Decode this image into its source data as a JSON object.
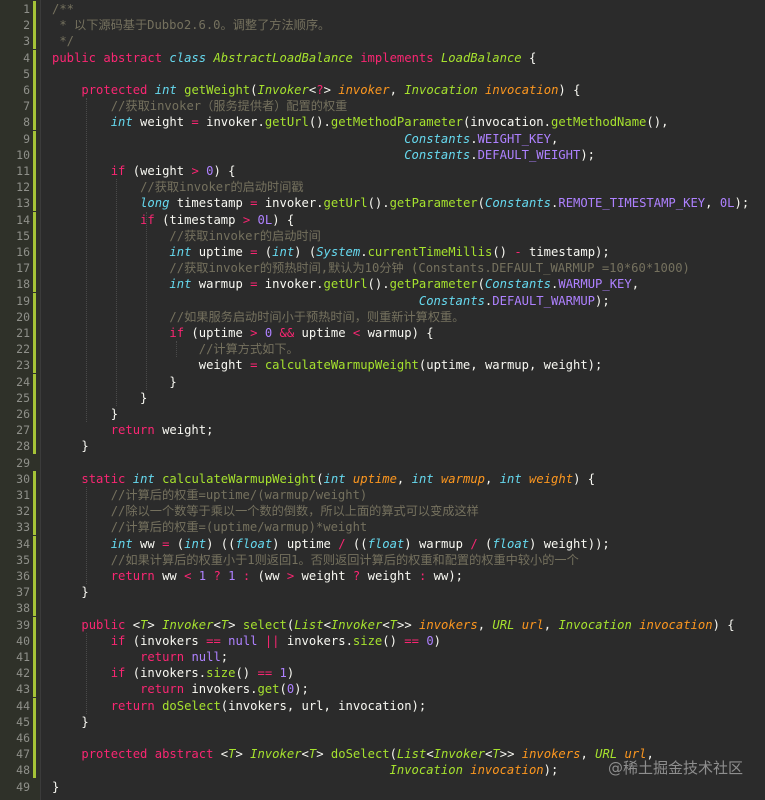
{
  "editor": {
    "theme_colors": {
      "background": "#2b2b2b",
      "line_number": "#8f908a",
      "change_marker": "#a6c437",
      "keyword": "#f92672",
      "type": "#66d9ef",
      "function": "#a6e22e",
      "class_name": "#a6e22e",
      "parameter": "#fd971f",
      "number": "#ae81ff",
      "comment": "#75715e",
      "text": "#f8f8f2"
    },
    "modified_lines": [
      1,
      2,
      3,
      4,
      5,
      6,
      7,
      8,
      9,
      10,
      11,
      12,
      13,
      14,
      15,
      16,
      17,
      18,
      19,
      20,
      21,
      22,
      23,
      24,
      25,
      26,
      27,
      28,
      30,
      31,
      32,
      33,
      34,
      35,
      36,
      37,
      38,
      39,
      40,
      41,
      42,
      43,
      44,
      45,
      46,
      47,
      48
    ],
    "lines": [
      [
        [
          "/**",
          "cm"
        ]
      ],
      [
        [
          " * 以下源码基于Dubbo2.6.0。调整了方法顺序。",
          "cm"
        ]
      ],
      [
        [
          " */",
          "cm"
        ]
      ],
      [
        [
          "public",
          "kw"
        ],
        [
          " ",
          ""
        ],
        [
          "abstract",
          "kw"
        ],
        [
          " ",
          ""
        ],
        [
          "class",
          "ty"
        ],
        [
          " ",
          ""
        ],
        [
          "AbstractLoadBalance",
          "cl"
        ],
        [
          " ",
          ""
        ],
        [
          "implements",
          "kw"
        ],
        [
          " ",
          ""
        ],
        [
          "LoadBalance",
          "cl"
        ],
        [
          " {",
          ""
        ]
      ],
      [
        [
          "",
          ""
        ]
      ],
      [
        [
          "    ",
          ""
        ],
        [
          "protected",
          "kw"
        ],
        [
          " ",
          ""
        ],
        [
          "int",
          "ty"
        ],
        [
          " ",
          ""
        ],
        [
          "getWeight",
          "fn"
        ],
        [
          "(",
          ""
        ],
        [
          "Invoker",
          "cl"
        ],
        [
          "<",
          ""
        ],
        [
          "?",
          "kw"
        ],
        [
          "> ",
          ""
        ],
        [
          "invoker",
          "pa"
        ],
        [
          ", ",
          ""
        ],
        [
          "Invocation",
          "cl"
        ],
        [
          " ",
          ""
        ],
        [
          "invocation",
          "pa"
        ],
        [
          ") {",
          ""
        ]
      ],
      [
        [
          "        ",
          ""
        ],
        [
          "//获取invoker（服务提供者）配置的权重",
          "cm"
        ]
      ],
      [
        [
          "        ",
          ""
        ],
        [
          "int",
          "ty"
        ],
        [
          " weight ",
          ""
        ],
        [
          "=",
          "kw"
        ],
        [
          " invoker.",
          ""
        ],
        [
          "getUrl",
          "fn"
        ],
        [
          "().",
          ""
        ],
        [
          "getMethodParameter",
          "fn"
        ],
        [
          "(invocation.",
          ""
        ],
        [
          "getMethodName",
          "fn"
        ],
        [
          "(),",
          ""
        ]
      ],
      [
        [
          "                                                ",
          ""
        ],
        [
          "Constants",
          "ty"
        ],
        [
          ".",
          ""
        ],
        [
          "WEIGHT_KEY",
          "nu"
        ],
        [
          ",",
          ""
        ]
      ],
      [
        [
          "                                                ",
          ""
        ],
        [
          "Constants",
          "ty"
        ],
        [
          ".",
          ""
        ],
        [
          "DEFAULT_WEIGHT",
          "nu"
        ],
        [
          ");",
          ""
        ]
      ],
      [
        [
          "        ",
          ""
        ],
        [
          "if",
          "kw"
        ],
        [
          " (weight ",
          ""
        ],
        [
          ">",
          "kw"
        ],
        [
          " ",
          ""
        ],
        [
          "0",
          "nu"
        ],
        [
          ") {",
          ""
        ]
      ],
      [
        [
          "            ",
          ""
        ],
        [
          "//获取invoker的启动时间戳",
          "cm"
        ]
      ],
      [
        [
          "            ",
          ""
        ],
        [
          "long",
          "ty"
        ],
        [
          " timestamp ",
          ""
        ],
        [
          "=",
          "kw"
        ],
        [
          " invoker.",
          ""
        ],
        [
          "getUrl",
          "fn"
        ],
        [
          "().",
          ""
        ],
        [
          "getParameter",
          "fn"
        ],
        [
          "(",
          ""
        ],
        [
          "Constants",
          "ty"
        ],
        [
          ".",
          ""
        ],
        [
          "REMOTE_TIMESTAMP_KEY",
          "nu"
        ],
        [
          ", ",
          ""
        ],
        [
          "0L",
          "nu"
        ],
        [
          ");",
          ""
        ]
      ],
      [
        [
          "            ",
          ""
        ],
        [
          "if",
          "kw"
        ],
        [
          " (timestamp ",
          ""
        ],
        [
          ">",
          "kw"
        ],
        [
          " ",
          ""
        ],
        [
          "0L",
          "nu"
        ],
        [
          ") {",
          ""
        ]
      ],
      [
        [
          "                ",
          ""
        ],
        [
          "//获取invoker的启动时间",
          "cm"
        ]
      ],
      [
        [
          "                ",
          ""
        ],
        [
          "int",
          "ty"
        ],
        [
          " uptime ",
          ""
        ],
        [
          "=",
          "kw"
        ],
        [
          " (",
          ""
        ],
        [
          "int",
          "ty"
        ],
        [
          ") (",
          ""
        ],
        [
          "System",
          "ty"
        ],
        [
          ".",
          ""
        ],
        [
          "currentTimeMillis",
          "fn"
        ],
        [
          "() ",
          ""
        ],
        [
          "-",
          "kw"
        ],
        [
          " timestamp);",
          ""
        ]
      ],
      [
        [
          "                ",
          ""
        ],
        [
          "//获取invoker的预热时间,默认为10分钟 (Constants.DEFAULT_WARMUP =10*60*1000)",
          "cm"
        ]
      ],
      [
        [
          "                ",
          ""
        ],
        [
          "int",
          "ty"
        ],
        [
          " warmup ",
          ""
        ],
        [
          "=",
          "kw"
        ],
        [
          " invoker.",
          ""
        ],
        [
          "getUrl",
          "fn"
        ],
        [
          "().",
          ""
        ],
        [
          "getParameter",
          "fn"
        ],
        [
          "(",
          ""
        ],
        [
          "Constants",
          "ty"
        ],
        [
          ".",
          ""
        ],
        [
          "WARMUP_KEY",
          "nu"
        ],
        [
          ",",
          ""
        ]
      ],
      [
        [
          "                                                  ",
          ""
        ],
        [
          "Constants",
          "ty"
        ],
        [
          ".",
          ""
        ],
        [
          "DEFAULT_WARMUP",
          "nu"
        ],
        [
          ");",
          ""
        ]
      ],
      [
        [
          "                ",
          ""
        ],
        [
          "//如果服务启动时间小于预热时间，则重新计算权重。",
          "cm"
        ]
      ],
      [
        [
          "                ",
          ""
        ],
        [
          "if",
          "kw"
        ],
        [
          " (uptime ",
          ""
        ],
        [
          ">",
          "kw"
        ],
        [
          " ",
          ""
        ],
        [
          "0",
          "nu"
        ],
        [
          " ",
          ""
        ],
        [
          "&&",
          "kw"
        ],
        [
          " uptime ",
          ""
        ],
        [
          "<",
          "kw"
        ],
        [
          " warmup) {",
          ""
        ]
      ],
      [
        [
          "                    ",
          ""
        ],
        [
          "//计算方式如下。",
          "cm"
        ]
      ],
      [
        [
          "                    ",
          ""
        ],
        [
          "weight ",
          ""
        ],
        [
          "=",
          "kw"
        ],
        [
          " ",
          ""
        ],
        [
          "calculateWarmupWeight",
          "fn"
        ],
        [
          "(uptime, warmup, weight);",
          ""
        ]
      ],
      [
        [
          "                }",
          ""
        ]
      ],
      [
        [
          "            }",
          ""
        ]
      ],
      [
        [
          "        }",
          ""
        ]
      ],
      [
        [
          "        ",
          ""
        ],
        [
          "return",
          "kw"
        ],
        [
          " weight;",
          ""
        ]
      ],
      [
        [
          "    }",
          ""
        ]
      ],
      [
        [
          "",
          ""
        ]
      ],
      [
        [
          "    ",
          ""
        ],
        [
          "static",
          "kw"
        ],
        [
          " ",
          ""
        ],
        [
          "int",
          "ty"
        ],
        [
          " ",
          ""
        ],
        [
          "calculateWarmupWeight",
          "fn"
        ],
        [
          "(",
          ""
        ],
        [
          "int",
          "ty"
        ],
        [
          " ",
          ""
        ],
        [
          "uptime",
          "pa"
        ],
        [
          ", ",
          ""
        ],
        [
          "int",
          "ty"
        ],
        [
          " ",
          ""
        ],
        [
          "warmup",
          "pa"
        ],
        [
          ", ",
          ""
        ],
        [
          "int",
          "ty"
        ],
        [
          " ",
          ""
        ],
        [
          "weight",
          "pa"
        ],
        [
          ") {",
          ""
        ]
      ],
      [
        [
          "        ",
          ""
        ],
        [
          "//计算后的权重=uptime/(warmup/weight)",
          "cm"
        ]
      ],
      [
        [
          "        ",
          ""
        ],
        [
          "//除以一个数等于乘以一个数的倒数，所以上面的算式可以变成这样",
          "cm"
        ]
      ],
      [
        [
          "        ",
          ""
        ],
        [
          "//计算后的权重=(uptime/warmup)*weight",
          "cm"
        ]
      ],
      [
        [
          "        ",
          ""
        ],
        [
          "int",
          "ty"
        ],
        [
          " ww ",
          ""
        ],
        [
          "=",
          "kw"
        ],
        [
          " (",
          ""
        ],
        [
          "int",
          "ty"
        ],
        [
          ") ((",
          ""
        ],
        [
          "float",
          "ty"
        ],
        [
          ") uptime ",
          ""
        ],
        [
          "/",
          "kw"
        ],
        [
          " ((",
          ""
        ],
        [
          "float",
          "ty"
        ],
        [
          ") warmup ",
          ""
        ],
        [
          "/",
          "kw"
        ],
        [
          " (",
          ""
        ],
        [
          "float",
          "ty"
        ],
        [
          ") weight));",
          ""
        ]
      ],
      [
        [
          "        ",
          ""
        ],
        [
          "//如果计算后的权重小于1则返回1。否则返回计算后的权重和配置的权重中较小的一个",
          "cm"
        ]
      ],
      [
        [
          "        ",
          ""
        ],
        [
          "return",
          "kw"
        ],
        [
          " ww ",
          ""
        ],
        [
          "<",
          "kw"
        ],
        [
          " ",
          ""
        ],
        [
          "1",
          "nu"
        ],
        [
          " ",
          ""
        ],
        [
          "?",
          "kw"
        ],
        [
          " ",
          ""
        ],
        [
          "1",
          "nu"
        ],
        [
          " ",
          ""
        ],
        [
          ":",
          "kw"
        ],
        [
          " (ww ",
          ""
        ],
        [
          ">",
          "kw"
        ],
        [
          " weight ",
          ""
        ],
        [
          "?",
          "kw"
        ],
        [
          " weight ",
          ""
        ],
        [
          ":",
          "kw"
        ],
        [
          " ww);",
          ""
        ]
      ],
      [
        [
          "    }",
          ""
        ]
      ],
      [
        [
          "",
          ""
        ]
      ],
      [
        [
          "    ",
          ""
        ],
        [
          "public",
          "kw"
        ],
        [
          " <",
          ""
        ],
        [
          "T",
          "cl"
        ],
        [
          "> ",
          ""
        ],
        [
          "Invoker",
          "cl"
        ],
        [
          "<",
          ""
        ],
        [
          "T",
          "cl"
        ],
        [
          "> ",
          ""
        ],
        [
          "select",
          "fn"
        ],
        [
          "(",
          ""
        ],
        [
          "List",
          "cl"
        ],
        [
          "<",
          ""
        ],
        [
          "Invoker",
          "cl"
        ],
        [
          "<",
          ""
        ],
        [
          "T",
          "cl"
        ],
        [
          ">> ",
          ""
        ],
        [
          "invokers",
          "pa"
        ],
        [
          ", ",
          ""
        ],
        [
          "URL",
          "cl"
        ],
        [
          " ",
          ""
        ],
        [
          "url",
          "pa"
        ],
        [
          ", ",
          ""
        ],
        [
          "Invocation",
          "cl"
        ],
        [
          " ",
          ""
        ],
        [
          "invocation",
          "pa"
        ],
        [
          ") {",
          ""
        ]
      ],
      [
        [
          "        ",
          ""
        ],
        [
          "if",
          "kw"
        ],
        [
          " (invokers ",
          ""
        ],
        [
          "==",
          "kw"
        ],
        [
          " ",
          ""
        ],
        [
          "null",
          "nu"
        ],
        [
          " ",
          ""
        ],
        [
          "||",
          "kw"
        ],
        [
          " invokers.",
          ""
        ],
        [
          "size",
          "fn"
        ],
        [
          "() ",
          ""
        ],
        [
          "==",
          "kw"
        ],
        [
          " ",
          ""
        ],
        [
          "0",
          "nu"
        ],
        [
          ")",
          ""
        ]
      ],
      [
        [
          "            ",
          ""
        ],
        [
          "return",
          "kw"
        ],
        [
          " ",
          ""
        ],
        [
          "null",
          "nu"
        ],
        [
          ";",
          ""
        ]
      ],
      [
        [
          "        ",
          ""
        ],
        [
          "if",
          "kw"
        ],
        [
          " (invokers.",
          ""
        ],
        [
          "size",
          "fn"
        ],
        [
          "() ",
          ""
        ],
        [
          "==",
          "kw"
        ],
        [
          " ",
          ""
        ],
        [
          "1",
          "nu"
        ],
        [
          ")",
          ""
        ]
      ],
      [
        [
          "            ",
          ""
        ],
        [
          "return",
          "kw"
        ],
        [
          " invokers.",
          ""
        ],
        [
          "get",
          "fn"
        ],
        [
          "(",
          ""
        ],
        [
          "0",
          "nu"
        ],
        [
          ");",
          ""
        ]
      ],
      [
        [
          "        ",
          ""
        ],
        [
          "return",
          "kw"
        ],
        [
          " ",
          ""
        ],
        [
          "doSelect",
          "fn"
        ],
        [
          "(invokers, url, invocation);",
          ""
        ]
      ],
      [
        [
          "    }",
          ""
        ]
      ],
      [
        [
          "",
          ""
        ]
      ],
      [
        [
          "    ",
          ""
        ],
        [
          "protected",
          "kw"
        ],
        [
          " ",
          ""
        ],
        [
          "abstract",
          "kw"
        ],
        [
          " <",
          ""
        ],
        [
          "T",
          "cl"
        ],
        [
          "> ",
          ""
        ],
        [
          "Invoker",
          "cl"
        ],
        [
          "<",
          ""
        ],
        [
          "T",
          "cl"
        ],
        [
          "> ",
          ""
        ],
        [
          "doSelect",
          "fn"
        ],
        [
          "(",
          ""
        ],
        [
          "List",
          "cl"
        ],
        [
          "<",
          ""
        ],
        [
          "Invoker",
          "cl"
        ],
        [
          "<",
          ""
        ],
        [
          "T",
          "cl"
        ],
        [
          ">> ",
          ""
        ],
        [
          "invokers",
          "pa"
        ],
        [
          ", ",
          ""
        ],
        [
          "URL",
          "cl"
        ],
        [
          " ",
          ""
        ],
        [
          "url",
          "pa"
        ],
        [
          ",",
          ""
        ]
      ],
      [
        [
          "                                              ",
          ""
        ],
        [
          "Invocation",
          "cl"
        ],
        [
          " ",
          ""
        ],
        [
          "invocation",
          "pa"
        ],
        [
          ");",
          ""
        ]
      ],
      [
        [
          "}",
          ""
        ]
      ]
    ]
  },
  "watermark": {
    "text": "@稀土掘金技术社区"
  }
}
